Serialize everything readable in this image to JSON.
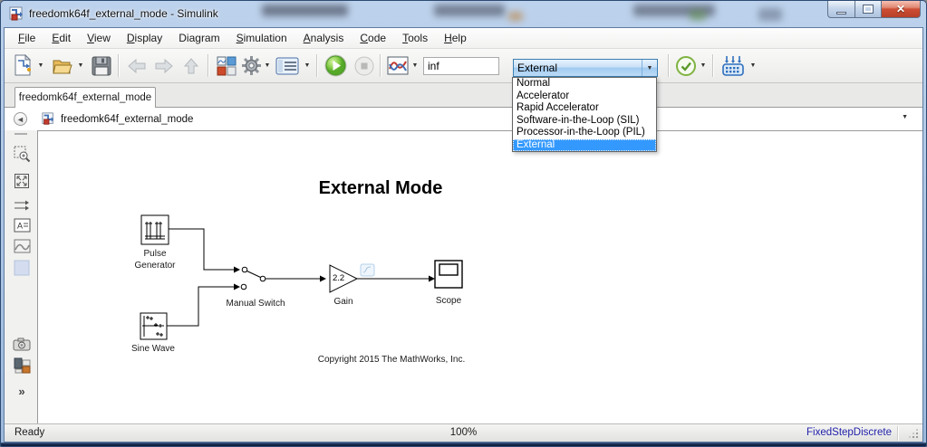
{
  "window": {
    "title": "freedomk64f_external_mode - Simulink"
  },
  "menu": {
    "items": [
      {
        "pre": "",
        "mn": "F",
        "post": "ile"
      },
      {
        "pre": "",
        "mn": "E",
        "post": "dit"
      },
      {
        "pre": "",
        "mn": "V",
        "post": "iew"
      },
      {
        "pre": "",
        "mn": "D",
        "post": "isplay"
      },
      {
        "pre": "Dia",
        "mn": "g",
        "post": "ram"
      },
      {
        "pre": "",
        "mn": "S",
        "post": "imulation"
      },
      {
        "pre": "",
        "mn": "A",
        "post": "nalysis"
      },
      {
        "pre": "",
        "mn": "C",
        "post": "ode"
      },
      {
        "pre": "",
        "mn": "T",
        "post": "ools"
      },
      {
        "pre": "",
        "mn": "H",
        "post": "elp"
      }
    ]
  },
  "toolbar": {
    "sim_time": "inf",
    "mode": "External"
  },
  "mode_dropdown": {
    "selected": "External",
    "options": [
      "Normal",
      "Accelerator",
      "Rapid Accelerator",
      "Software-in-the-Loop (SIL)",
      "Processor-in-the-Loop (PIL)",
      "External"
    ]
  },
  "tab": {
    "label": "freedomk64f_external_mode"
  },
  "breadcrumb": {
    "model": "freedomk64f_external_mode"
  },
  "canvas": {
    "title": "External Mode",
    "copyright": "Copyright 2015 The MathWorks, Inc.",
    "blocks": {
      "pulse1": "Pulse",
      "pulse2": "Generator",
      "sine": "Sine Wave",
      "switch": "Manual Switch",
      "gain": "Gain",
      "gain_value": "2.2",
      "scope": "Scope"
    }
  },
  "statusbar": {
    "status": "Ready",
    "zoom": "100%",
    "solver": "FixedStepDiscrete"
  },
  "icons": {
    "caret": "▼",
    "back": "◄",
    "expand": "»",
    "close": "✕"
  },
  "colors": {
    "selection": "#3399ff",
    "run_green": "#5cb82e",
    "solver_text": "#2222aa",
    "close_red": "#c94733"
  }
}
